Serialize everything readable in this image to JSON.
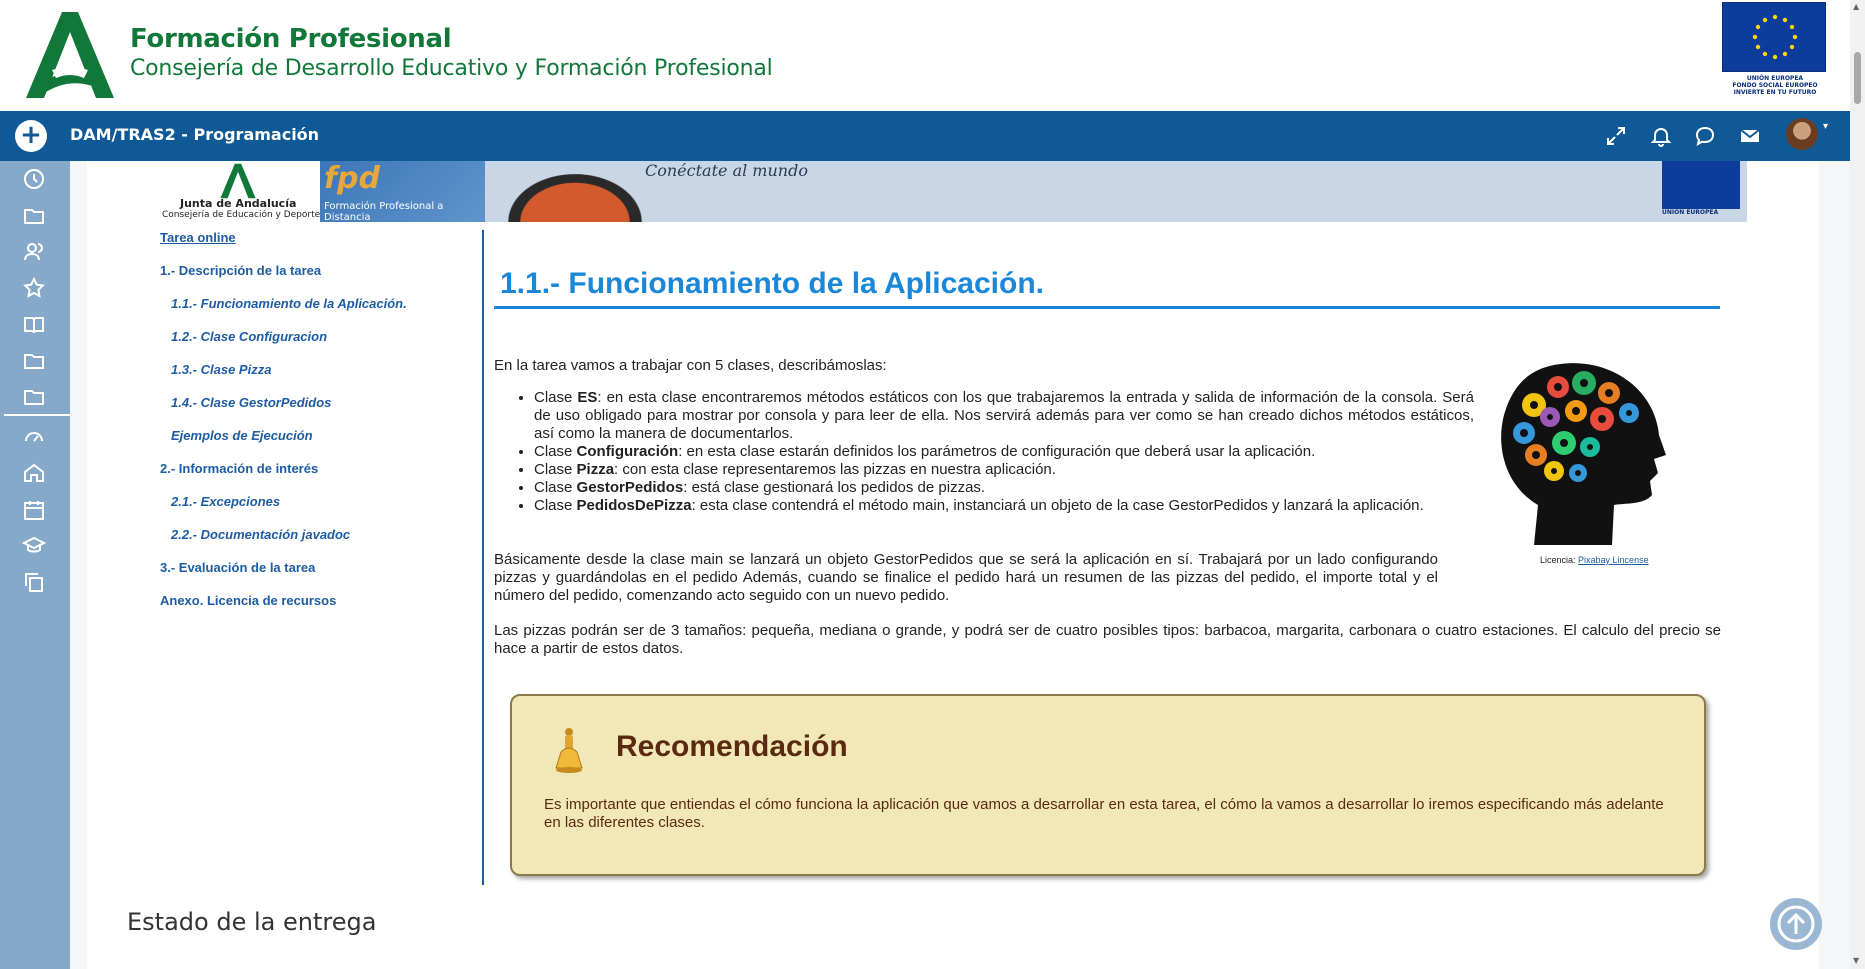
{
  "header": {
    "brand_title": "Formación Profesional",
    "brand_subtitle": "Consejería de Desarrollo Educativo y Formación Profesional",
    "eu_text": "UNIÓN EUROPEA\nFONDO SOCIAL EUROPEO\nINVIERTE EN TU FUTURO"
  },
  "navbar": {
    "course_title": "DAM/TRAS2 - Programación",
    "icons": [
      "expand-icon",
      "bell-icon",
      "chat-icon",
      "envelope-icon"
    ]
  },
  "sidebar": {
    "icons": [
      "clock-icon",
      "folder-icon",
      "users-icon",
      "star-icon",
      "book-icon",
      "folder-icon",
      "folder-icon",
      "dashboard-icon",
      "home-icon",
      "calendar-icon",
      "graduation-cap-icon",
      "copy-icon"
    ]
  },
  "banner": {
    "junta_name": "Junta de Andalucía",
    "junta_sub": "Consejería de Educación y Deporte",
    "fpd_logo": "fpd",
    "fpd_text": "Formación Profesional a Distancia",
    "slogan": "Conéctate al mundo",
    "eu_label": "UNIÓN EUROPEA"
  },
  "toc": {
    "items": [
      {
        "label": "Tarea online",
        "level": 1
      },
      {
        "label": "1.- Descripción de la tarea",
        "level": 1
      },
      {
        "label": "1.1.- Funcionamiento de la Aplicación.",
        "level": 2
      },
      {
        "label": "1.2.- Clase Configuracion",
        "level": 2
      },
      {
        "label": "1.3.- Clase Pizza",
        "level": 2
      },
      {
        "label": "1.4.- Clase GestorPedidos",
        "level": 2
      },
      {
        "label": "Ejemplos de Ejecución",
        "level": 2
      },
      {
        "label": "2.- Información de interés",
        "level": 1
      },
      {
        "label": "2.1.- Excepciones",
        "level": 2
      },
      {
        "label": "2.2.- Documentación javadoc",
        "level": 2
      },
      {
        "label": "3.- Evaluación de la tarea",
        "level": 1
      },
      {
        "label": "Anexo. Licencia de recursos",
        "level": 1
      }
    ]
  },
  "article": {
    "title": "1.1.- Funcionamiento de la Aplicación.",
    "intro": "En la tarea vamos a trabajar con 5 clases, describámoslas:",
    "list": [
      {
        "prefix": "Clase ",
        "name": "ES",
        "text": ": en esta clase encontraremos métodos estáticos con los que trabajaremos la entrada y salida de información de la consola. Será de uso obligado para mostrar por consola y para leer de ella. Nos servirá además para ver como se han creado dichos métodos estáticos, así como la manera de documentarlos."
      },
      {
        "prefix": "Clase ",
        "name": "Configuración",
        "text": ": en esta clase estarán definidos los parámetros de configuración que deberá usar la aplicación."
      },
      {
        "prefix": "Clase ",
        "name": "Pizza",
        "text": ": con esta clase representaremos las pizzas en nuestra aplicación."
      },
      {
        "prefix": "Clase ",
        "name": "GestorPedidos",
        "text": ": está clase gestionará los pedidos de pizzas."
      },
      {
        "prefix": "Clase ",
        "name": "PedidosDePizza",
        "text": ": esta clase contendrá el método main, instanciará un objeto de la case GestorPedidos y lanzará la aplicación."
      }
    ],
    "para1": "Básicamente desde la clase main se lanzará un objeto GestorPedidos que se será la aplicación en sí. Trabajará por un lado configurando pizzas y guardándolas en el pedido Además, cuando se finalice el pedido hará un resumen de las pizzas del pedido, el importe total y el número del pedido, comenzando acto seguido con un nuevo pedido.",
    "para2": "Las pizzas podrán ser de 3 tamaños: pequeña, mediana o grande, y podrá ser de cuatro posibles tipos: barbacoa, margarita, carbonara o cuatro estaciones. El calculo del precio se hace a partir de estos datos.",
    "licence_label": "Licencia: ",
    "licence_link": "Pixabay Lincense"
  },
  "recommendation": {
    "title": "Recomendación",
    "text": "Es importante que entiendas el cómo funciona la aplicación que vamos a desarrollar en esta tarea, el cómo la vamos a desarrollar lo iremos especificando más adelante en las diferentes clases."
  },
  "status": {
    "heading": "Estado de la entrega"
  }
}
